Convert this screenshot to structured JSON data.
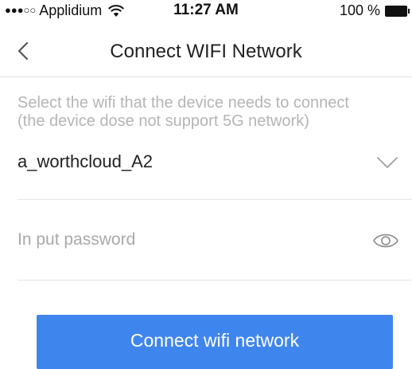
{
  "status_bar": {
    "signal_dots": "●●●○○",
    "carrier": "Applidium",
    "time": "11:27 AM",
    "battery": "100 %"
  },
  "nav": {
    "title": "Connect WIFI Network"
  },
  "hint": {
    "line1": "Select the wifi that the device needs to connect",
    "line2": "(the device dose not support 5G network)"
  },
  "wifi": {
    "selected": "a_worthcloud_A2"
  },
  "password": {
    "placeholder": "In put password",
    "value": ""
  },
  "connect_button": {
    "label": "Connect wifi network"
  },
  "colors": {
    "accent": "#3f85ee",
    "hint_text": "#b5b5b5",
    "divider": "#e3e3e3"
  },
  "icons": {
    "back": "chevron-left-icon",
    "wifi_select": "chevron-down-icon",
    "password_visibility": "eye-icon",
    "status_wifi": "wifi-signal-icon",
    "battery": "battery-icon"
  }
}
